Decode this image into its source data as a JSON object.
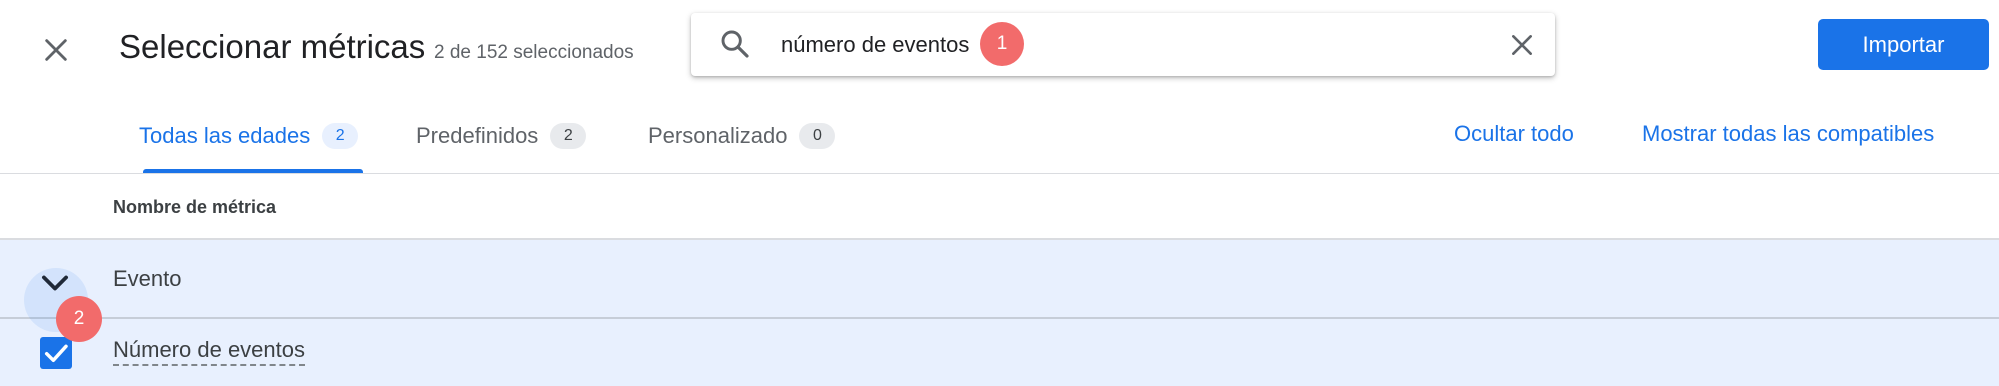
{
  "header": {
    "title": "Seleccionar métricas",
    "selection_summary": "2 de 152 seleccionados",
    "import_label": "Importar"
  },
  "search": {
    "value": "número de eventos",
    "badge": "1"
  },
  "tabs": [
    {
      "label": "Todas las edades",
      "count": "2",
      "active": true
    },
    {
      "label": "Predefinidos",
      "count": "2",
      "active": false
    },
    {
      "label": "Personalizado",
      "count": "0",
      "active": false
    }
  ],
  "actions": {
    "hide_all": "Ocultar todo",
    "show_all_compatible": "Mostrar todas las compatibles"
  },
  "table": {
    "column_header": "Nombre de métrica",
    "group": {
      "label": "Evento",
      "expanded": true
    },
    "items": [
      {
        "label": "Número de eventos",
        "checked": true,
        "badge": "2"
      }
    ]
  },
  "colors": {
    "accent": "#1a73e8",
    "selected_row": "#e8f0fe",
    "badge": "#f26b6b"
  }
}
